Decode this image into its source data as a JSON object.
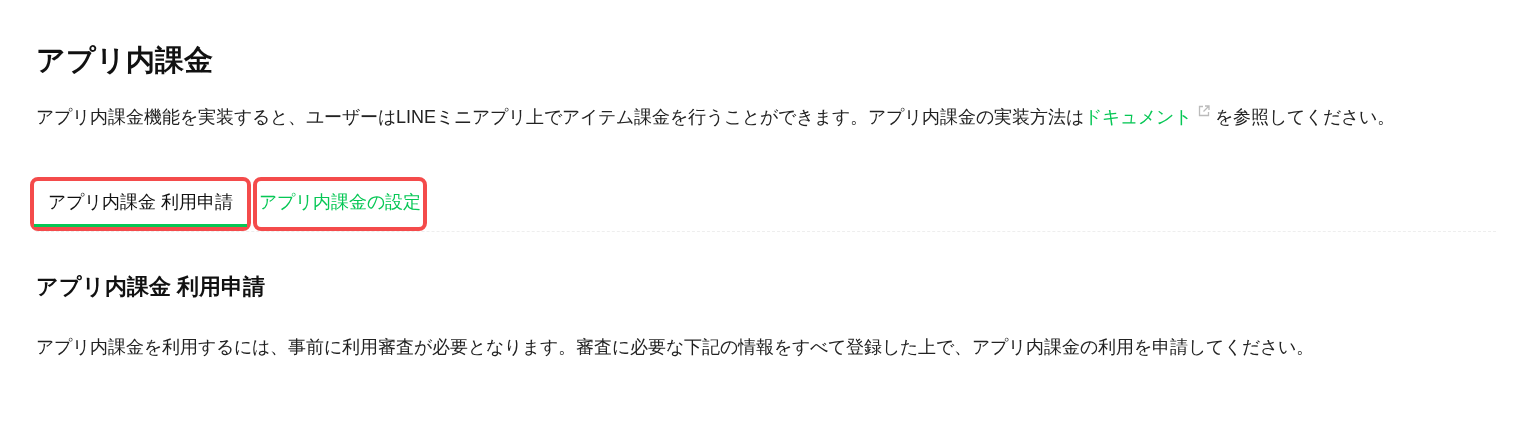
{
  "title": "アプリ内課金",
  "description": {
    "before": "アプリ内課金機能を実装すると、ユーザーはLINEミニアプリ上でアイテム課金を行うことができます。アプリ内課金の実装方法は",
    "link": "ドキュメント",
    "after": " を参照してください。"
  },
  "tabs": [
    {
      "label": "アプリ内課金 利用申請",
      "selected": true,
      "highlighted": true
    },
    {
      "label": "アプリ内課金の設定",
      "selected": false,
      "highlighted": true
    }
  ],
  "section": {
    "heading": "アプリ内課金 利用申請",
    "text": "アプリ内課金を利用するには、事前に利用審査が必要となります。審査に必要な下記の情報をすべて登録した上で、アプリ内課金の利用を申請してください。"
  }
}
